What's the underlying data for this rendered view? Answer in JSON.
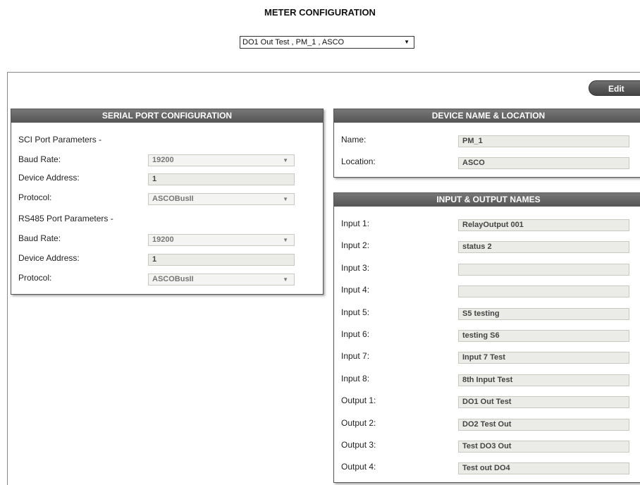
{
  "page": {
    "title": "METER CONFIGURATION"
  },
  "meter_selector": {
    "value": "DO1 Out Test ,  PM_1 ,  ASCO"
  },
  "toolbar": {
    "edit_label": "Edit"
  },
  "serial": {
    "header": "SERIAL PORT CONFIGURATION",
    "sci_section": "SCI Port Parameters -",
    "sci_baud_label": "Baud Rate:",
    "sci_baud_value": "19200",
    "sci_addr_label": "Device Address:",
    "sci_addr_value": "1",
    "sci_proto_label": "Protocol:",
    "sci_proto_value": "ASCOBusII",
    "rs485_section": "RS485 Port Parameters -",
    "rs485_baud_label": "Baud Rate:",
    "rs485_baud_value": "19200",
    "rs485_addr_label": "Device Address:",
    "rs485_addr_value": "1",
    "rs485_proto_label": "Protocol:",
    "rs485_proto_value": "ASCOBusII"
  },
  "device": {
    "header": "DEVICE NAME & LOCATION",
    "name_label": "Name:",
    "name_value": "PM_1",
    "location_label": "Location:",
    "location_value": "ASCO"
  },
  "io": {
    "header": "INPUT & OUTPUT NAMES",
    "items": [
      {
        "label": "Input 1:",
        "value": "RelayOutput 001"
      },
      {
        "label": "Input 2:",
        "value": "status 2"
      },
      {
        "label": "Input 3:",
        "value": ""
      },
      {
        "label": "Input 4:",
        "value": ""
      },
      {
        "label": "Input 5:",
        "value": "S5 testing"
      },
      {
        "label": "Input 6:",
        "value": "testing S6"
      },
      {
        "label": "Input 7:",
        "value": "Input 7 Test"
      },
      {
        "label": "Input 8:",
        "value": "8th Input Test"
      },
      {
        "label": "Output 1:",
        "value": "DO1 Out Test"
      },
      {
        "label": "Output 2:",
        "value": "DO2 Test Out"
      },
      {
        "label": "Output 3:",
        "value": "Test DO3 Out"
      },
      {
        "label": "Output 4:",
        "value": "Test out DO4"
      }
    ]
  }
}
